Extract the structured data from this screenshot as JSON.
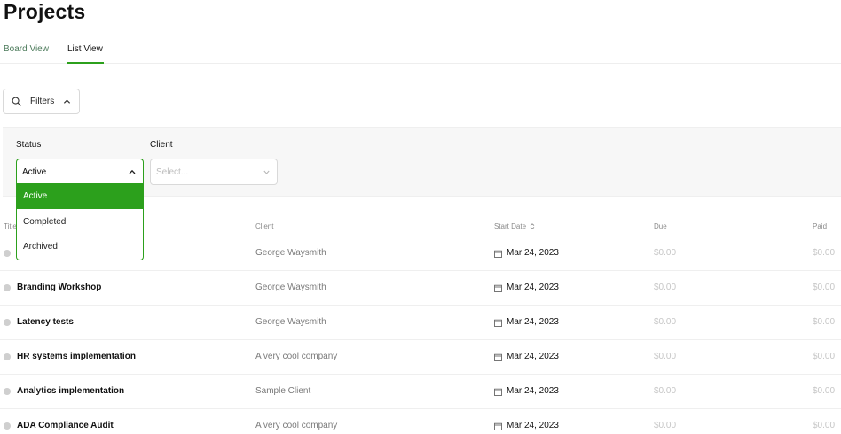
{
  "page": {
    "title": "Projects"
  },
  "tabs": [
    {
      "label": "Board View",
      "active": false
    },
    {
      "label": "List View",
      "active": true
    }
  ],
  "filters": {
    "button_label": "Filters",
    "status": {
      "label": "Status",
      "value": "Active",
      "options": [
        "Active",
        "Completed",
        "Archived"
      ]
    },
    "client": {
      "label": "Client",
      "placeholder": "Select..."
    }
  },
  "table": {
    "columns": [
      "Title",
      "Client",
      "Start Date",
      "Due",
      "Paid"
    ],
    "rows": [
      {
        "title": "",
        "client": "George Waysmith",
        "start": "Mar 24, 2023",
        "due": "$0.00",
        "paid": "$0.00"
      },
      {
        "title": "Branding Workshop",
        "client": "George Waysmith",
        "start": "Mar 24, 2023",
        "due": "$0.00",
        "paid": "$0.00"
      },
      {
        "title": "Latency tests",
        "client": "George Waysmith",
        "start": "Mar 24, 2023",
        "due": "$0.00",
        "paid": "$0.00"
      },
      {
        "title": "HR systems implementation",
        "client": "A very cool company",
        "start": "Mar 24, 2023",
        "due": "$0.00",
        "paid": "$0.00"
      },
      {
        "title": "Analytics implementation",
        "client": "Sample Client",
        "start": "Mar 24, 2023",
        "due": "$0.00",
        "paid": "$0.00"
      },
      {
        "title": "ADA Compliance Audit",
        "client": "A very cool company",
        "start": "Mar 24, 2023",
        "due": "$0.00",
        "paid": "$0.00"
      }
    ]
  },
  "colors": {
    "accent": "#2ca01c",
    "muted_text": "#7a7a7a",
    "amount_text": "#c6c6c6"
  }
}
